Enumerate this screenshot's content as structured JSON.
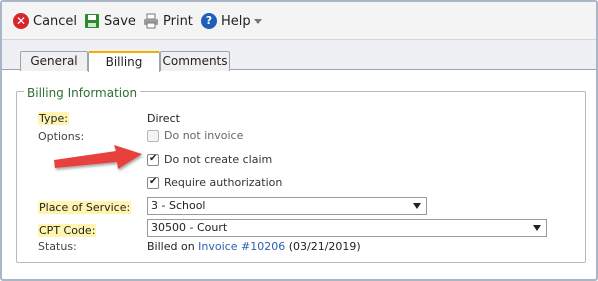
{
  "toolbar": {
    "cancel_label": "Cancel",
    "save_label": "Save",
    "print_label": "Print",
    "help_label": "Help"
  },
  "tabs": [
    {
      "label": "General",
      "active": false
    },
    {
      "label": "Billing",
      "active": true
    },
    {
      "label": "Comments",
      "active": false
    }
  ],
  "billing": {
    "legend": "Billing Information",
    "type_label": "Type:",
    "type_value": "Direct",
    "options_label": "Options:",
    "options": [
      {
        "label": "Do not invoice",
        "checked": false,
        "disabled": true
      },
      {
        "label": "Do not create claim",
        "checked": true,
        "disabled": false
      },
      {
        "label": "Require authorization",
        "checked": true,
        "disabled": false
      }
    ],
    "place_of_service_label": "Place of Service:",
    "place_of_service_value": "3 - School",
    "cpt_code_label": "CPT Code:",
    "cpt_code_value": "30500 - Court",
    "status_label": "Status:",
    "status_prefix": "Billed on",
    "status_link": "Invoice #10206",
    "status_date": "(03/21/2019)"
  },
  "colors": {
    "arrow": "#e8403d",
    "legend": "#2f6e2f",
    "link": "#2b5fb0",
    "required_highlight": "#fff5b0",
    "active_tab_top": "#f0b000"
  }
}
